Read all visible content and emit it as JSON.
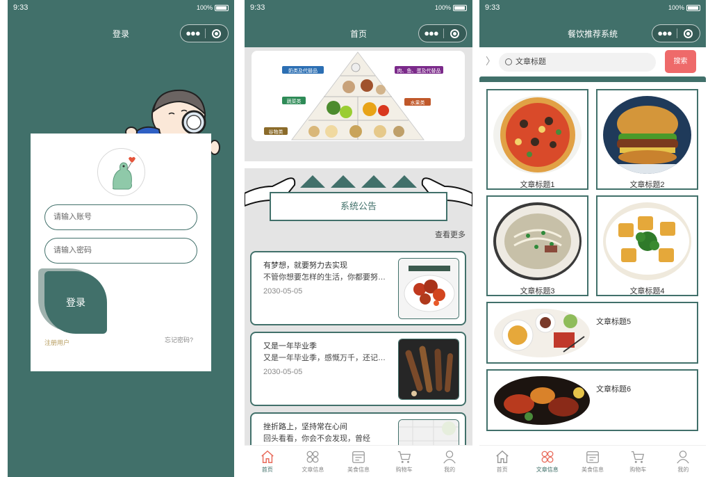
{
  "status": {
    "time": "9:33",
    "battery": "100%"
  },
  "login_screen": {
    "title": "登录",
    "account_placeholder": "请输入账号",
    "password_placeholder": "请输入密码",
    "login_button": "登录",
    "register_link": "注册用户",
    "forgot_link": "忘记密码?"
  },
  "home_screen": {
    "title": "首页",
    "notice_title": "系统公告",
    "more_link": "查看更多",
    "pyramid_labels": [
      "奶类及代替品",
      "肉、鱼、蛋及代替品",
      "蔬菜类",
      "水果类",
      "谷物类"
    ],
    "news": [
      {
        "title": "有梦想，就要努力去实现",
        "summary": "不管你想要怎样的生活，你都要努力去争取",
        "date": "2030-05-05"
      },
      {
        "title": "又是一年毕业季",
        "summary": "又是一年毕业季，感慨万千，还记得当年",
        "date": "2030-05-05"
      },
      {
        "title": "挫折路上，坚持常在心间",
        "summary": "回头看看，你会不会发现，曾经",
        "date": ""
      }
    ],
    "tabs": [
      {
        "label": "首页",
        "icon": "home-icon",
        "active": true
      },
      {
        "label": "文章信息",
        "icon": "article-icon",
        "active": false
      },
      {
        "label": "美食信息",
        "icon": "food-icon",
        "active": false
      },
      {
        "label": "购物车",
        "icon": "cart-icon",
        "active": false
      },
      {
        "label": "我的",
        "icon": "user-icon",
        "active": false
      }
    ]
  },
  "list_screen": {
    "title": "餐饮推荐系统",
    "search_value": "文章标题",
    "search_button": "搜索",
    "articles": [
      "文章标题1",
      "文章标题2",
      "文章标题3",
      "文章标题4",
      "文章标题5",
      "文章标题6"
    ],
    "tabs": [
      {
        "label": "首页",
        "icon": "home-icon",
        "active": false
      },
      {
        "label": "文章信息",
        "icon": "article-icon",
        "active": true
      },
      {
        "label": "美食信息",
        "icon": "food-icon",
        "active": false
      },
      {
        "label": "购物车",
        "icon": "cart-icon",
        "active": false
      },
      {
        "label": "我的",
        "icon": "user-icon",
        "active": false
      }
    ]
  },
  "colors": {
    "primary": "#41706a",
    "search_button": "#ee6a6a",
    "register_link": "#b69b5c"
  }
}
